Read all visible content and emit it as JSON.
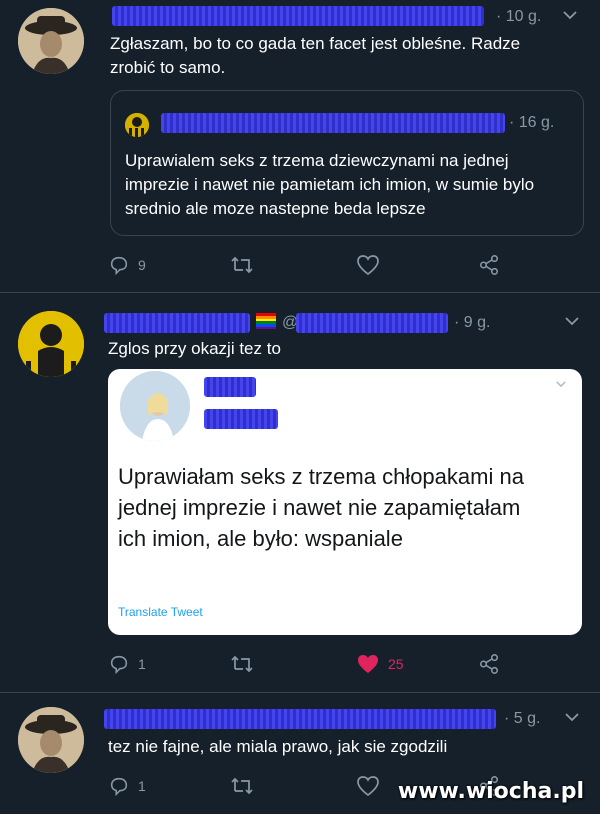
{
  "tweets": [
    {
      "time": "· 10 g.",
      "text": "Zgłaszam, bo to co gada ten facet jest obleśne. Radze zrobić to samo.",
      "quote": {
        "time": "· 16 g.",
        "text": "Uprawialem seks z trzema dziewczynami na jednej imprezie i nawet nie pamietam ich imion, w sumie bylo srednio ale moze nastepne beda lepsze"
      },
      "actions": {
        "reply_count": "9",
        "like_count": ""
      }
    },
    {
      "handle_prefix": "@",
      "time": "· 9 g.",
      "text": "Zglos przy okazji tez to",
      "embedded_card": {
        "text": "Uprawiałam seks z trzema chłopakami na jednej imprezie i nawet nie zapamiętałam ich imion, ale było: wspaniale",
        "translate": "Translate Tweet"
      },
      "actions": {
        "reply_count": "1",
        "like_count": "25"
      }
    },
    {
      "time": "· 5 g.",
      "text": "tez nie fajne, ale miala prawo, jak sie zgodzili",
      "actions": {
        "reply_count": "1",
        "like_count": ""
      }
    }
  ],
  "watermark": "www.wiocha.pl",
  "colors": {
    "background": "#15202b",
    "like_active": "#e0245e",
    "link": "#1da1f2"
  }
}
